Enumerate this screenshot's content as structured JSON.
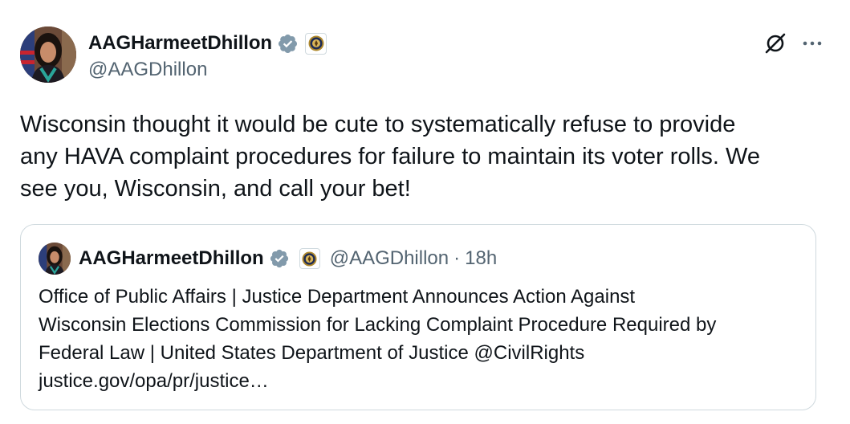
{
  "author": {
    "display_name": "AAGHarmeetDhillon",
    "handle": "@AAGDhillon"
  },
  "icons": {
    "verified": "verified-badge-icon",
    "affiliation": "doj-seal-icon",
    "grok": "grok-icon",
    "more": "more-icon"
  },
  "tweet": {
    "lines": [
      "Wisconsin thought it would be cute to systematically refuse to provide",
      "any HAVA complaint procedures for failure to maintain its voter rolls. We",
      "see you, Wisconsin, and call your bet!"
    ]
  },
  "quote": {
    "display_name": "AAGHarmeetDhillon",
    "handle": "@AAGDhillon",
    "separator": "·",
    "time": "18h",
    "lines": [
      "Office of Public Affairs | Justice Department Announces Action Against",
      "Wisconsin Elections Commission for Lacking Complaint Procedure Required by",
      "Federal Law | United States Department of Justice @CivilRights",
      "justice.gov/opa/pr/justice…"
    ]
  },
  "colors": {
    "text_primary": "#0f1419",
    "text_secondary": "#536471",
    "border": "#cfd9de",
    "verified_badge": "#829aab"
  }
}
